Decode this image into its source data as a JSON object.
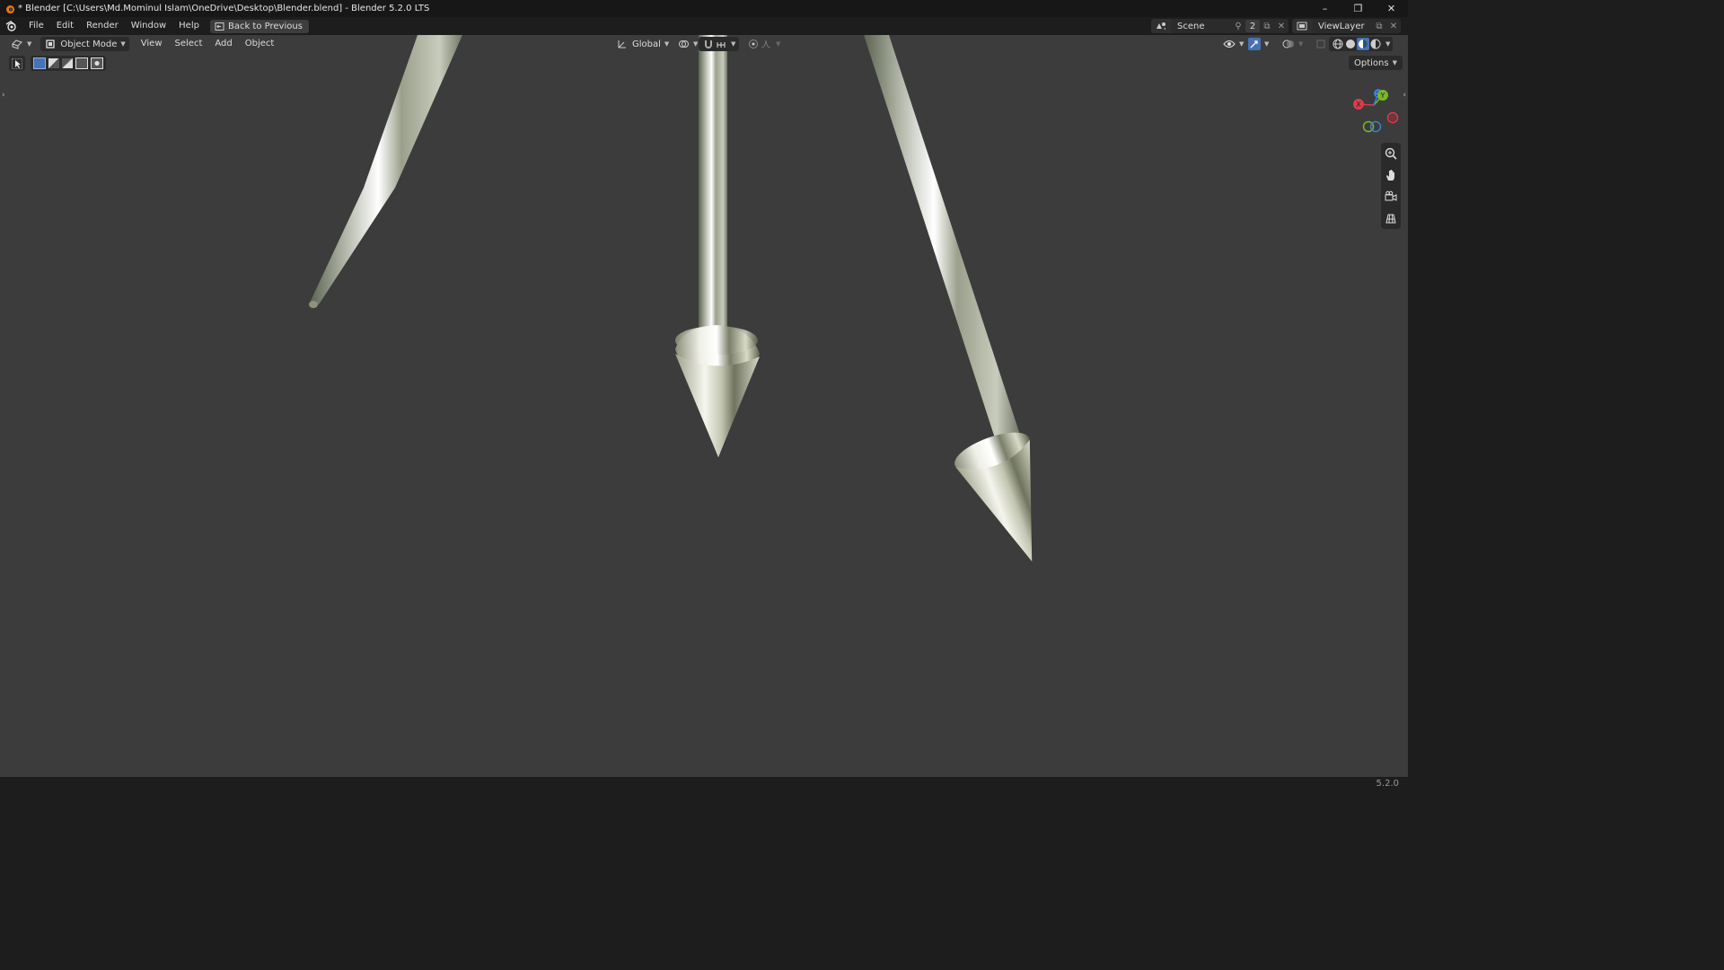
{
  "window": {
    "title": "* Blender [C:\\Users\\Md.Mominul Islam\\OneDrive\\Desktop\\Blender.blend] - Blender 5.2.0 LTS",
    "minimize": "–",
    "maximize": "❐",
    "close": "✕"
  },
  "menu": {
    "items": [
      "File",
      "Edit",
      "Render",
      "Window",
      "Help"
    ],
    "back_button": "Back to Previous"
  },
  "scene": {
    "name": "Scene",
    "count": "2"
  },
  "view_layer": {
    "name": "ViewLayer"
  },
  "viewport_header": {
    "mode": "Object Mode",
    "menus": [
      "View",
      "Select",
      "Add",
      "Object"
    ],
    "transform_orientation": "Global"
  },
  "options_label": "Options",
  "gizmo": {
    "x": "X",
    "y": "Y",
    "z": "Z"
  },
  "status": {
    "version": "5.2.0"
  },
  "colors": {
    "viewport_bg": "#3c3c3c",
    "header_bg": "#1d1d1d",
    "accent_blue": "#4772b3",
    "axis_x": "#e03a4c",
    "axis_y": "#79b829",
    "axis_z": "#3a7fd0"
  }
}
